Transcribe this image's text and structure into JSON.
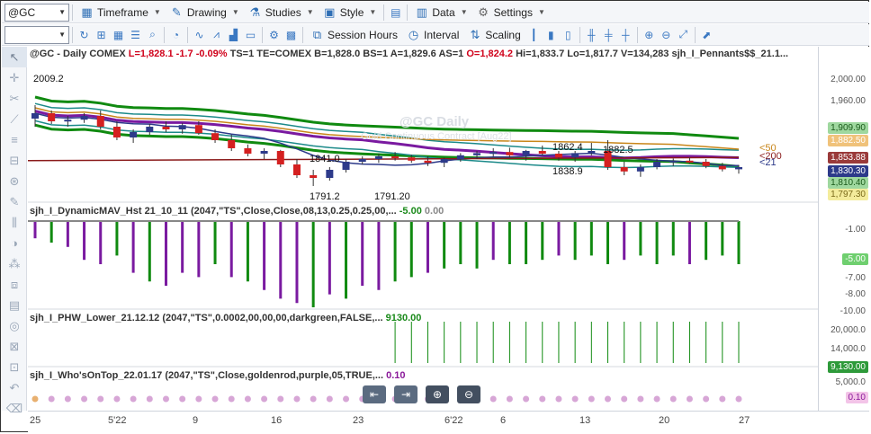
{
  "toolbar": {
    "symbol": "@GC",
    "timeframe": "Timeframe",
    "drawing": "Drawing",
    "studies": "Studies",
    "style": "Style",
    "data": "Data",
    "settings": "Settings",
    "session_hours": "Session Hours",
    "interval": "Interval",
    "scaling": "Scaling"
  },
  "info": {
    "prefix": "@GC - Daily  COMEX",
    "l": "L=1,828.1",
    "chg": "-1.7",
    "pct": "-0.09%",
    "rest1": "TS=1  TE=COMEX  B=1,828.0  BS=1  A=1,829.6  AS=1",
    "o": "O=1,824.2",
    "rest2": "Hi=1,833.7  Lo=1,817.7  V=134,283  sjh_I_Pennants$$_21.1..."
  },
  "watermark": "@GC Daily",
  "watermark_sub": "Gold Continuous Contract [Aug22]",
  "price_labels": {
    "hi_left": "2009.2",
    "l1": "1841.0",
    "l2": "1791.2",
    "l3": "1791.20",
    "l4": "1862.4",
    "l5": "1882.5",
    "l6": "1838.9",
    "ma50": "<50",
    "ma200": "<200",
    "ma21": "<21"
  },
  "panes": {
    "p2": {
      "name": "sjh_I_DynamicMAV_Hst 21_10_11 (2047,\"TS\",Close,Close,08,13,0.25,0.25,00,...",
      "v1": "-5.00",
      "v2": "0.00"
    },
    "p3": {
      "name": "sjh_I_PHW_Lower_21.12.12 (2047,\"TS\",0.0002,00,00,00,darkgreen,FALSE,...",
      "v1": "9130.00"
    },
    "p4": {
      "name": "sjh_I_Who'sOnTop_22.01.17 (2047,\"TS\",Close,goldenrod,purple,05,TRUE,...",
      "v1": "0.10"
    }
  },
  "right_axis": {
    "main": [
      "2,000.00",
      "1,960.00",
      "1,909.90",
      "1,882.50",
      "1,853.88",
      "1,830.30",
      "1,810.40",
      "1,797.30"
    ],
    "p2": [
      "-1.00",
      "-5.00",
      "-7.00",
      "-8.00",
      "-10.00"
    ],
    "p3": [
      "20,000.0",
      "14,000.0",
      "9,130.00",
      "5,000.0"
    ],
    "p4": [
      "0.10"
    ]
  },
  "x_labels": [
    "25",
    "5'22",
    "9",
    "16",
    "23",
    "6'22",
    "6",
    "13",
    "20",
    "27"
  ],
  "colors": {
    "up": "#2d3a8a",
    "down": "#d42020",
    "green_band": "#108a10",
    "teal": "#1c8a8a",
    "purple": "#7a1aa0",
    "gold": "#c8861a",
    "maroon": "#8a1a1a"
  },
  "chart_data": [
    {
      "type": "candlestick",
      "title": "@GC - Daily COMEX",
      "ylim": [
        1770,
        2020
      ],
      "annotations": [
        "2009.2",
        "1841.0",
        "1791.2",
        "1791.20",
        "1862.4",
        "1882.5",
        "1838.9"
      ],
      "ohlc": [
        [
          1920,
          1945,
          1905,
          1930
        ],
        [
          1930,
          1935,
          1910,
          1915
        ],
        [
          1915,
          1925,
          1905,
          1918
        ],
        [
          1918,
          1930,
          1912,
          1925
        ],
        [
          1925,
          1935,
          1900,
          1905
        ],
        [
          1905,
          1915,
          1880,
          1885
        ],
        [
          1885,
          1900,
          1875,
          1895
        ],
        [
          1895,
          1910,
          1890,
          1905
        ],
        [
          1905,
          1915,
          1895,
          1900
        ],
        [
          1900,
          1912,
          1892,
          1908
        ],
        [
          1908,
          1915,
          1890,
          1893
        ],
        [
          1893,
          1900,
          1875,
          1880
        ],
        [
          1880,
          1890,
          1860,
          1865
        ],
        [
          1865,
          1872,
          1850,
          1855
        ],
        [
          1855,
          1865,
          1845,
          1860
        ],
        [
          1860,
          1862,
          1830,
          1835
        ],
        [
          1835,
          1845,
          1810,
          1815
        ],
        [
          1815,
          1825,
          1795,
          1810
        ],
        [
          1810,
          1830,
          1805,
          1825
        ],
        [
          1825,
          1845,
          1820,
          1840
        ],
        [
          1840,
          1850,
          1835,
          1845
        ],
        [
          1845,
          1855,
          1838,
          1850
        ],
        [
          1850,
          1858,
          1842,
          1848
        ],
        [
          1848,
          1853,
          1838,
          1842
        ],
        [
          1842,
          1850,
          1832,
          1838
        ],
        [
          1838,
          1848,
          1830,
          1845
        ],
        [
          1845,
          1856,
          1840,
          1852
        ],
        [
          1852,
          1860,
          1845,
          1856
        ],
        [
          1856,
          1865,
          1850,
          1858
        ],
        [
          1858,
          1866,
          1848,
          1852
        ],
        [
          1852,
          1862,
          1842,
          1860
        ],
        [
          1860,
          1870,
          1852,
          1855
        ],
        [
          1855,
          1860,
          1842,
          1848
        ],
        [
          1848,
          1860,
          1840,
          1856
        ],
        [
          1856,
          1875,
          1852,
          1860
        ],
        [
          1860,
          1880,
          1825,
          1830
        ],
        [
          1830,
          1840,
          1815,
          1822
        ],
        [
          1822,
          1835,
          1812,
          1830
        ],
        [
          1830,
          1845,
          1826,
          1840
        ],
        [
          1840,
          1846,
          1832,
          1842
        ],
        [
          1842,
          1848,
          1836,
          1840
        ],
        [
          1840,
          1845,
          1828,
          1832
        ],
        [
          1832,
          1838,
          1822,
          1826
        ],
        [
          1826,
          1834,
          1818,
          1830
        ]
      ]
    },
    {
      "type": "bar",
      "title": "sjh_I_DynamicMAV_Hst 21_10_11",
      "ylim": [
        -10,
        0
      ],
      "values": [
        -2,
        -2.5,
        -3,
        -4.5,
        -5,
        -4,
        -6,
        -7,
        -7.5,
        -6,
        -6.5,
        -5,
        -6.5,
        -7,
        -8,
        -9,
        -9.5,
        -10,
        -8.5,
        -9,
        -7.5,
        -8,
        -7,
        -6.5,
        -6,
        -5.5,
        -5,
        -5.5,
        -4.5,
        -5,
        -5,
        -4.5,
        -4,
        -4.5,
        -4,
        -5,
        -4.5,
        -4,
        -5,
        -4,
        -5,
        -4.5,
        -4,
        -5
      ]
    },
    {
      "type": "bar",
      "title": "sjh_I_PHW_Lower_21.12.12",
      "ylim": [
        0,
        20000
      ],
      "values": [
        0,
        0,
        0,
        0,
        0,
        0,
        0,
        0,
        0,
        0,
        0,
        0,
        0,
        0,
        0,
        0,
        0,
        0,
        0,
        0,
        0,
        0,
        20000,
        20000,
        20000,
        20000,
        20000,
        20000,
        20000,
        20000,
        20000,
        20000,
        20000,
        20000,
        20000,
        20000,
        20000,
        20000,
        20000,
        20000,
        20000,
        20000,
        20000,
        20000
      ]
    }
  ]
}
